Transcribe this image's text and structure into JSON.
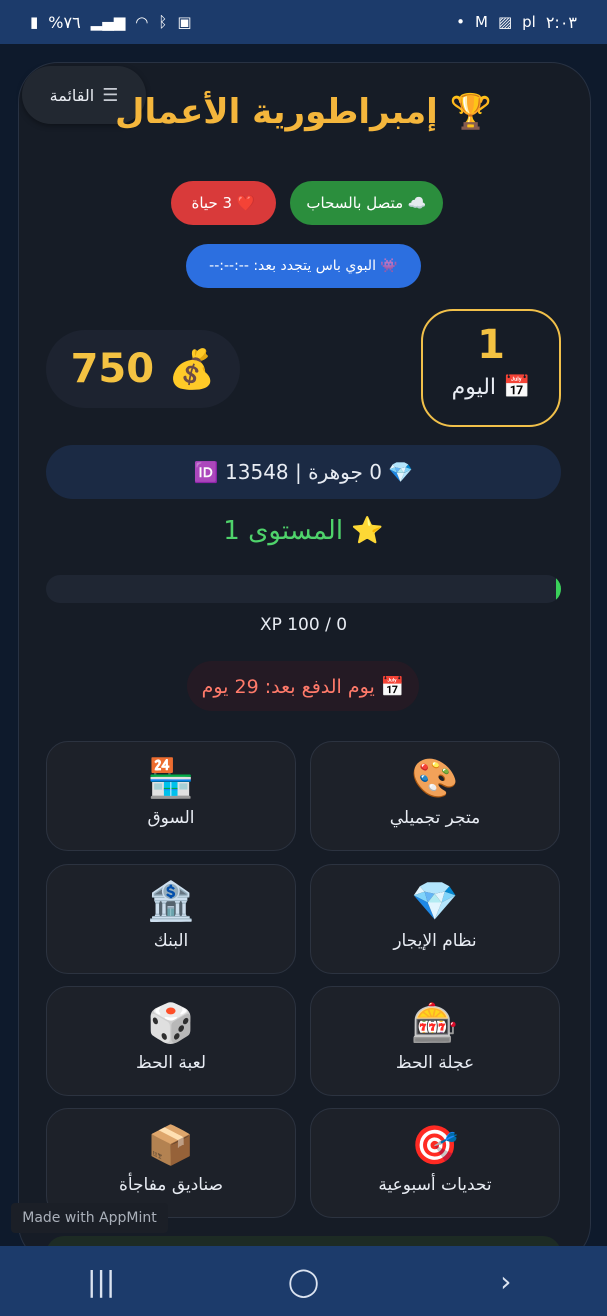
{
  "status_bar": {
    "time": "٢:٠٣",
    "battery": "%٧٦",
    "left_icons": [
      "battery-icon",
      "signal-icon",
      "wifi-icon",
      "bluetooth-icon",
      "nfc-icon"
    ],
    "right_icons": [
      "dot-icon",
      "gmail-icon",
      "gallery-icon",
      "pl-icon"
    ]
  },
  "menu": {
    "label": "القائمة",
    "icon": "hamburger-icon"
  },
  "app": {
    "title": "🏆 إمبراطورية الأعمال"
  },
  "badges": {
    "cloud": "☁️ متصل بالسحاب",
    "lives": "❤️ 3 حياة",
    "battle_pass": "👾 البوي باس يتجدد بعد: --:--:--"
  },
  "money": {
    "value": "750",
    "icon": "💰"
  },
  "day": {
    "number": "1",
    "label": "📅 اليوم"
  },
  "gems": {
    "text": "💎 0 جوهرة | 🆔 13548"
  },
  "level": {
    "text": "⭐ المستوى 1"
  },
  "xp": {
    "text": "XP 100 / 0",
    "progress": 0.01,
    "fill_color": "#3ad15a"
  },
  "payday": {
    "text": "📅 يوم الدفع بعد: 29 يوم"
  },
  "menu_cards": [
    {
      "icon": "🎨",
      "label": "متجر تجميلي"
    },
    {
      "icon": "🏪",
      "label": "السوق"
    },
    {
      "icon": "💎",
      "label": "نظام الإيجار"
    },
    {
      "icon": "🏦",
      "label": "البنك"
    },
    {
      "icon": "🎰",
      "label": "عجلة الحظ"
    },
    {
      "icon": "🎲",
      "label": "لعبة الحظ"
    },
    {
      "icon": "🎯",
      "label": "تحديات أسبوعية"
    },
    {
      "icon": "📦",
      "label": "صناديق مفاجأة"
    }
  ],
  "watermark": "Made with AppMint",
  "nav": {
    "recent": "|||",
    "home": "◯",
    "back": "›"
  },
  "colors": {
    "accent_gold": "#f4b63c",
    "level_green": "#4fd36b",
    "payday_red": "#ff7a6a"
  }
}
